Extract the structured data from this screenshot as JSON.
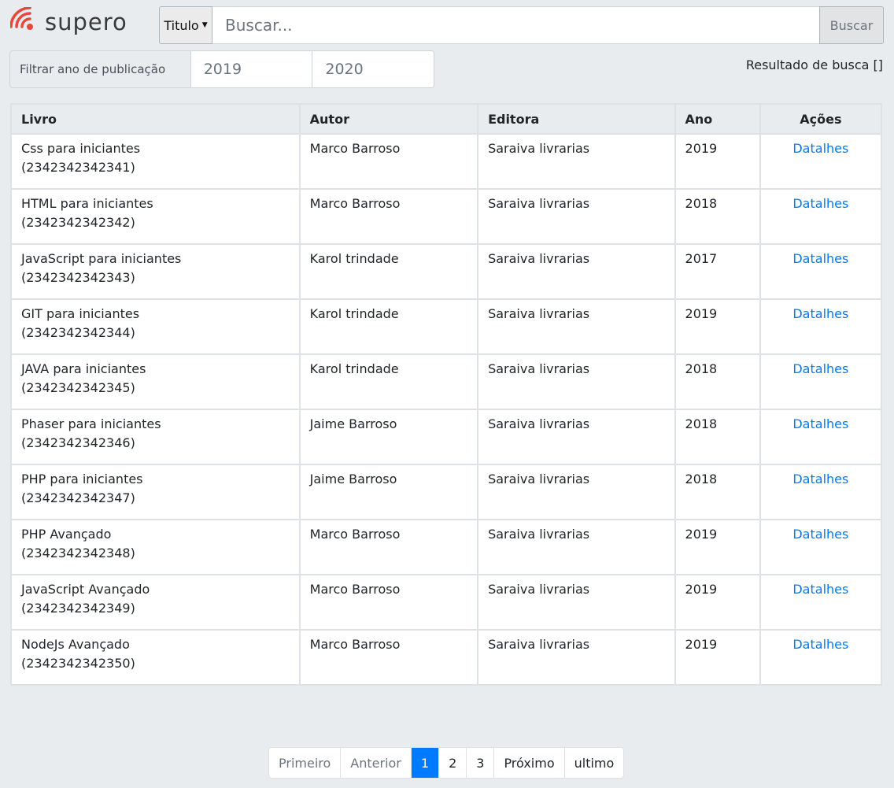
{
  "header": {
    "logo_text": "supero",
    "search": {
      "field_select": "Titulo",
      "placeholder": "Buscar...",
      "button_label": "Buscar"
    }
  },
  "filter": {
    "label": "Filtrar ano de publicação",
    "from_year": "2019",
    "to_year": "2020"
  },
  "result_text": "Resultado de busca []",
  "table": {
    "headers": [
      "Livro",
      "Autor",
      "Editora",
      "Ano",
      "Ações"
    ],
    "rows": [
      {
        "title": "Css para iniciantes",
        "isbn": "(2342342342341)",
        "author": "Marco Barroso",
        "publisher": "Saraiva livrarias",
        "year": "2019",
        "action": "Datalhes"
      },
      {
        "title": "HTML para iniciantes",
        "isbn": "(2342342342342)",
        "author": "Marco Barroso",
        "publisher": "Saraiva livrarias",
        "year": "2018",
        "action": "Datalhes"
      },
      {
        "title": "JavaScript para iniciantes",
        "isbn": "(2342342342343)",
        "author": "Karol trindade",
        "publisher": "Saraiva livrarias",
        "year": "2017",
        "action": "Datalhes"
      },
      {
        "title": "GIT para iniciantes",
        "isbn": "(2342342342344)",
        "author": "Karol trindade",
        "publisher": "Saraiva livrarias",
        "year": "2019",
        "action": "Datalhes"
      },
      {
        "title": "JAVA para iniciantes",
        "isbn": "(2342342342345)",
        "author": "Karol trindade",
        "publisher": "Saraiva livrarias",
        "year": "2018",
        "action": "Datalhes"
      },
      {
        "title": "Phaser para iniciantes",
        "isbn": "(2342342342346)",
        "author": "Jaime Barroso",
        "publisher": "Saraiva livrarias",
        "year": "2018",
        "action": "Datalhes"
      },
      {
        "title": "PHP para iniciantes",
        "isbn": "(2342342342347)",
        "author": "Jaime Barroso",
        "publisher": "Saraiva livrarias",
        "year": "2018",
        "action": "Datalhes"
      },
      {
        "title": "PHP Avançado",
        "isbn": "(2342342342348)",
        "author": "Marco Barroso",
        "publisher": "Saraiva livrarias",
        "year": "2019",
        "action": "Datalhes"
      },
      {
        "title": "JavaScript Avançado",
        "isbn": "(2342342342349)",
        "author": "Marco Barroso",
        "publisher": "Saraiva livrarias",
        "year": "2019",
        "action": "Datalhes"
      },
      {
        "title": "NodeJs Avançado",
        "isbn": "(2342342342350)",
        "author": "Marco Barroso",
        "publisher": "Saraiva livrarias",
        "year": "2019",
        "action": "Datalhes"
      }
    ]
  },
  "pagination": {
    "first": "Primeiro",
    "previous": "Anterior",
    "pages": [
      "1",
      "2",
      "3"
    ],
    "active_page": "1",
    "next": "Próximo",
    "last": "ultimo"
  },
  "colors": {
    "accent": "#007bff",
    "logo_accent": "#e8473b",
    "background": "#e9ecef"
  }
}
